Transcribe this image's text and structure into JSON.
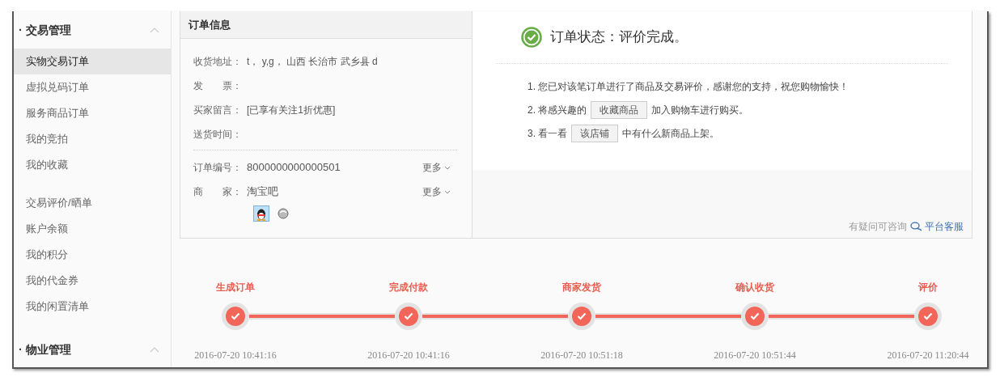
{
  "sidebar": {
    "groups": [
      {
        "title": "· 交易管理",
        "expanded": true,
        "sections": [
          [
            {
              "label": "实物交易订单",
              "selected": true
            },
            {
              "label": "虚拟兑码订单",
              "selected": false
            },
            {
              "label": "服务商品订单",
              "selected": false
            },
            {
              "label": "我的竞拍",
              "selected": false
            },
            {
              "label": "我的收藏",
              "selected": false
            }
          ],
          [
            {
              "label": "交易评价/晒单",
              "selected": false
            },
            {
              "label": "账户余额",
              "selected": false
            },
            {
              "label": "我的积分",
              "selected": false
            },
            {
              "label": "我的代金券",
              "selected": false
            },
            {
              "label": "我的闲置清单",
              "selected": false
            }
          ]
        ]
      },
      {
        "title": "· 物业管理",
        "expanded": true
      }
    ]
  },
  "order_info": {
    "title": "订单信息",
    "fields": [
      {
        "label": "收货地址：",
        "value": "t， y,g， 山西 长治市 武乡县 d"
      },
      {
        "label": "发　　票："
      },
      {
        "label": "买家留言：",
        "value": "[已享有关注1折优惠]"
      },
      {
        "label": "送货时间："
      }
    ],
    "details": [
      {
        "label": "订单编号：",
        "value": "8000000000000501",
        "more": "更多"
      },
      {
        "label": "商　　家：",
        "value": "淘宝吧",
        "more": "更多"
      }
    ]
  },
  "status": {
    "title": "订单状态：评价完成。",
    "steps": [
      {
        "before": "1. 您已对该笔订单进行了商品及交易评价，感谢您的支持，祝您购物愉快！"
      },
      {
        "before": "2. 将感兴趣的",
        "button": "收藏商品",
        "after": "加入购物车进行购买。"
      },
      {
        "before": "3. 看一看",
        "button": "该店铺",
        "after": "中有什么新商品上架。"
      }
    ],
    "help": "有疑问可咨询",
    "service_link": "平台客服"
  },
  "timeline": [
    {
      "label": "生成订单",
      "time": "2016-07-20 10:41:16",
      "done": true
    },
    {
      "label": "完成付款",
      "time": "2016-07-20 10:41:16",
      "done": true
    },
    {
      "label": "商家发货",
      "time": "2016-07-20 10:51:18",
      "done": true
    },
    {
      "label": "确认收货",
      "time": "2016-07-20 10:51:44",
      "done": true
    },
    {
      "label": "评价",
      "time": "2016-07-20 11:20:44",
      "done": true
    }
  ]
}
